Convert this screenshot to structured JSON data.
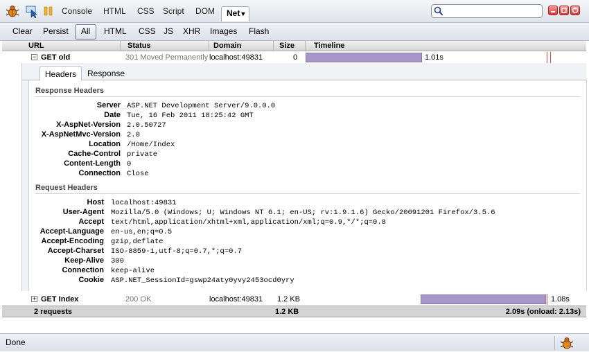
{
  "toolbar": {
    "tabs": [
      "Console",
      "HTML",
      "CSS",
      "Script",
      "DOM"
    ],
    "active_tab": "Net",
    "active_tab_arrow": "▾",
    "search_value": "",
    "icons": [
      "firebug-icon",
      "inspect-icon",
      "pause-icon",
      "search-icon",
      "minimize-icon",
      "restore-icon",
      "close-icon"
    ]
  },
  "filters": {
    "clear": "Clear",
    "persist": "Persist",
    "items": [
      "All",
      "HTML",
      "CSS",
      "JS",
      "XHR",
      "Images",
      "Flash"
    ],
    "selected": "All"
  },
  "columns": [
    "URL",
    "Status",
    "Domain",
    "Size",
    "Timeline"
  ],
  "requests": [
    {
      "toggle": "−",
      "url": "GET old",
      "status": "301 Moved Permanently",
      "domain": "localhost:49831",
      "size": "0",
      "time": "1.01s",
      "timeline_fraction": 0.4
    },
    {
      "toggle": "+",
      "url": "GET Index",
      "status": "200 OK",
      "domain": "localhost:49831",
      "size": "1.2 KB",
      "time": "1.08s",
      "timeline_fraction": 0.43
    }
  ],
  "detail": {
    "tabs": [
      "Headers",
      "Response"
    ],
    "response_title": "Response Headers",
    "response_headers": [
      {
        "k": "Server",
        "v": "ASP.NET Development Server/9.0.0.0"
      },
      {
        "k": "Date",
        "v": "Tue, 16 Feb 2011 18:25:42 GMT"
      },
      {
        "k": "X-AspNet-Version",
        "v": "2.0.50727"
      },
      {
        "k": "X-AspNetMvc-Version",
        "v": "2.0"
      },
      {
        "k": "Location",
        "v": "/Home/Index"
      },
      {
        "k": "Cache-Control",
        "v": "private"
      },
      {
        "k": "Content-Length",
        "v": "0"
      },
      {
        "k": "Connection",
        "v": "Close"
      }
    ],
    "request_title": "Request Headers",
    "request_headers": [
      {
        "k": "Host",
        "v": "localhost:49831"
      },
      {
        "k": "User-Agent",
        "v": "Mozilla/5.0 (Windows; U; Windows NT 6.1; en-US; rv:1.9.1.6) Gecko/20091201 Firefox/3.5.6"
      },
      {
        "k": "Accept",
        "v": "text/html,application/xhtml+xml,application/xml;q=0.9,*/*;q=0.8"
      },
      {
        "k": "Accept-Language",
        "v": "en-us,en;q=0.5"
      },
      {
        "k": "Accept-Encoding",
        "v": "gzip,deflate"
      },
      {
        "k": "Accept-Charset",
        "v": "ISO-8859-1,utf-8;q=0.7,*;q=0.7"
      },
      {
        "k": "Keep-Alive",
        "v": "300"
      },
      {
        "k": "Connection",
        "v": "keep-alive"
      },
      {
        "k": "Cookie",
        "v": "ASP.NET_SessionId=gswp24aty0yvy2453ocd0yry"
      }
    ]
  },
  "summary": {
    "count": "2 requests",
    "size": "1.2 KB",
    "time": "2.09s (onload: 2.13s)"
  },
  "status": {
    "text": "Done"
  },
  "colors": {
    "timeline_bar": "#a895c9",
    "close_button": "#d23c3c"
  }
}
